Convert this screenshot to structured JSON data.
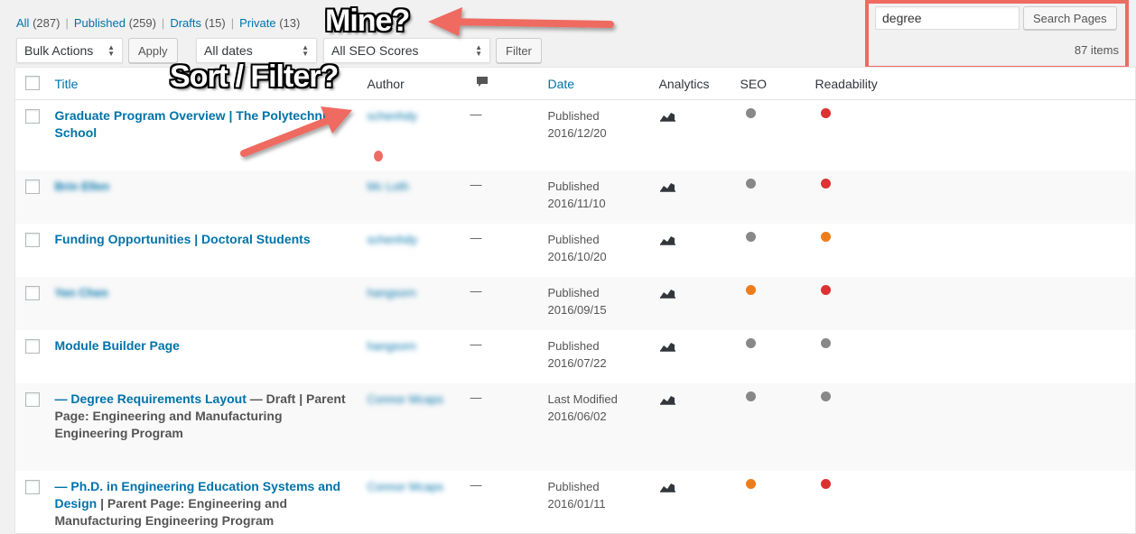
{
  "views": {
    "all": {
      "label": "All",
      "count": "(287)"
    },
    "published": {
      "label": "Published",
      "count": "(259)"
    },
    "drafts": {
      "label": "Drafts",
      "count": "(15)"
    },
    "private": {
      "label": "Private",
      "count": "(13)"
    }
  },
  "search": {
    "value": "degree",
    "button": "Search Pages"
  },
  "items_count": "87 items",
  "filters": {
    "bulk_actions": "Bulk Actions",
    "apply": "Apply",
    "dates": "All dates",
    "seo_scores": "All SEO Scores",
    "filter": "Filter"
  },
  "columns": {
    "title": "Title",
    "author": "Author",
    "date": "Date",
    "analytics": "Analytics",
    "seo": "SEO",
    "readability": "Readability"
  },
  "rows": [
    {
      "title": "Graduate Program Overview | The Polytechnic School",
      "title_rest": "",
      "author": "schenhdy",
      "comments": "—",
      "status": "Published",
      "date": "2016/12/20",
      "seo": "grey",
      "readability": "red"
    },
    {
      "title": "Brin Ellen",
      "title_rest": "",
      "author": "Mc Loth",
      "comments": "—",
      "status": "Published",
      "date": "2016/11/10",
      "seo": "grey",
      "readability": "red"
    },
    {
      "title": "Funding Opportunities | Doctoral Students",
      "title_rest": "",
      "author": "schenhdy",
      "comments": "—",
      "status": "Published",
      "date": "2016/10/20",
      "seo": "grey",
      "readability": "orange"
    },
    {
      "title": "Yen Chen",
      "title_rest": "",
      "author": "hangsorn",
      "comments": "—",
      "status": "Published",
      "date": "2016/09/15",
      "seo": "orange",
      "readability": "red"
    },
    {
      "title": "Module Builder Page",
      "title_rest": "",
      "author": "hangsorn",
      "comments": "—",
      "status": "Published",
      "date": "2016/07/22",
      "seo": "grey",
      "readability": "grey"
    },
    {
      "title": "— Degree Requirements Layout",
      "title_rest": " — Draft | Parent Page: Engineering and Manufacturing Engineering Program",
      "author": "Connor Mcaps",
      "comments": "—",
      "status": "Last Modified",
      "date": "2016/06/02",
      "seo": "grey",
      "readability": "grey"
    },
    {
      "title": "— Ph.D. in Engineering Education Systems and Design",
      "title_rest": " | Parent Page: Engineering and Manufacturing Engineering Program",
      "author": "Connor Mcaps",
      "comments": "—",
      "status": "Published",
      "date": "2016/01/11",
      "seo": "orange",
      "readability": "red"
    }
  ],
  "annotations": {
    "mine": "Mine?",
    "sort_filter": "Sort / Filter?"
  },
  "colors": {
    "link": "#0073aa",
    "annotation_arrow": "#ef6a61",
    "seo_grey": "#888888",
    "seo_red": "#dc3232",
    "seo_orange": "#ee7c1b"
  }
}
